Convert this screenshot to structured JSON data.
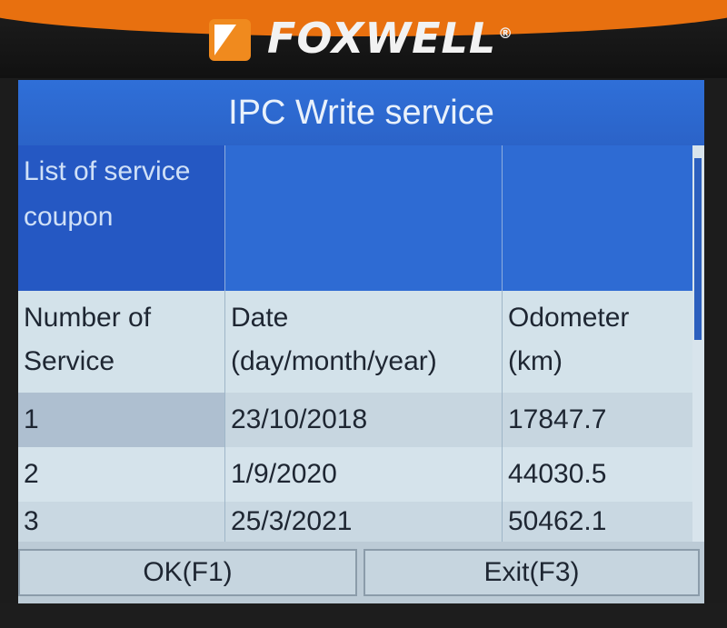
{
  "brand": {
    "name": "FOXWELL",
    "registered": "®"
  },
  "screen": {
    "title": "IPC Write service",
    "header_row": {
      "label": "List of service coupon"
    },
    "columns": [
      "Number of Service",
      "Date (day/month/year)",
      "Odometer (km)"
    ],
    "rows": [
      {
        "number": "1",
        "date": "23/10/2018",
        "odometer": "17847.7"
      },
      {
        "number": "2",
        "date": "1/9/2020",
        "odometer": "44030.5"
      },
      {
        "number": "3",
        "date": "25/3/2021",
        "odometer": "50462.1"
      }
    ]
  },
  "buttons": {
    "ok": "OK(F1)",
    "exit": "Exit(F3)"
  },
  "colors": {
    "title_bar": "#2f6fd8",
    "device_orange": "#e8700f",
    "screen_bg": "#cfdde6"
  }
}
